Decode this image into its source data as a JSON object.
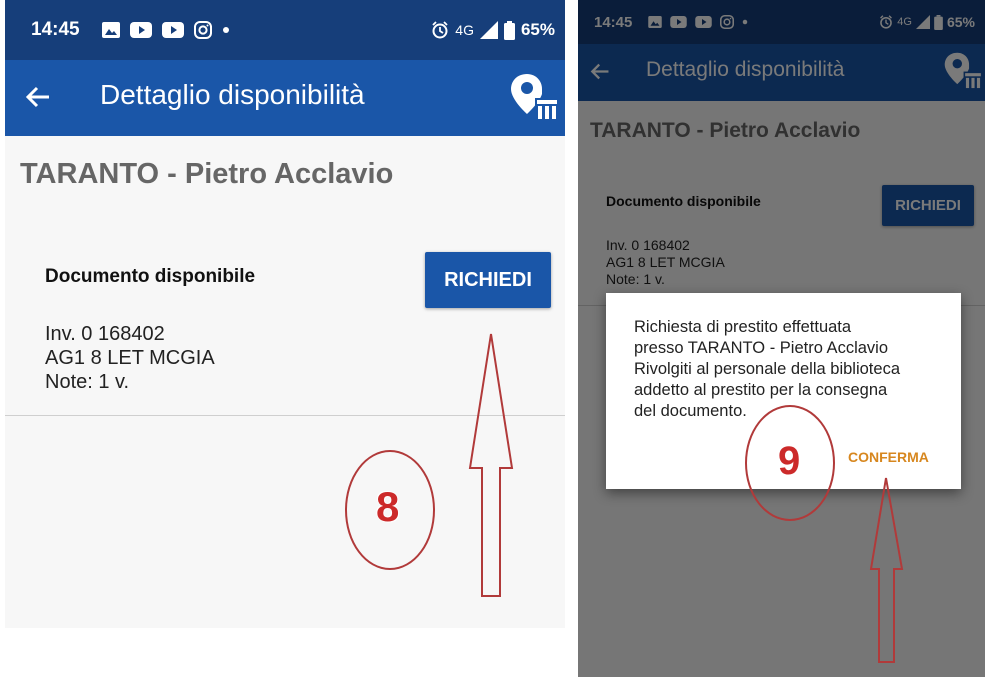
{
  "status_bar": {
    "time": "14:45",
    "network": "4G",
    "battery": "65%"
  },
  "app_bar": {
    "title": "Dettaglio disponibilità"
  },
  "library_name": "TARANTO - Pietro Acclavio",
  "document": {
    "status_label": "Documento disponibile",
    "request_button": "RICHIEDI",
    "inventory": "Inv. 0 168402",
    "location": "AG1 8 LET MCGIA",
    "note": "Note: 1 v."
  },
  "dialog": {
    "lines": [
      "Richiesta di prestito effettuata",
      "presso TARANTO - Pietro Acclavio",
      "Rivolgiti al personale della biblioteca",
      "addetto al prestito per la consegna",
      "del documento."
    ],
    "confirm_button": "CONFERMA"
  },
  "annotations": {
    "step_left": "8",
    "step_right": "9"
  },
  "colors": {
    "primary": "#1a56a8",
    "status_bar": "#163e7a",
    "accent": "#d7871f",
    "annotation": "#b13a3a"
  },
  "icons": {
    "back": "arrow-left-icon",
    "library_map": "map-pin-library-icon"
  }
}
